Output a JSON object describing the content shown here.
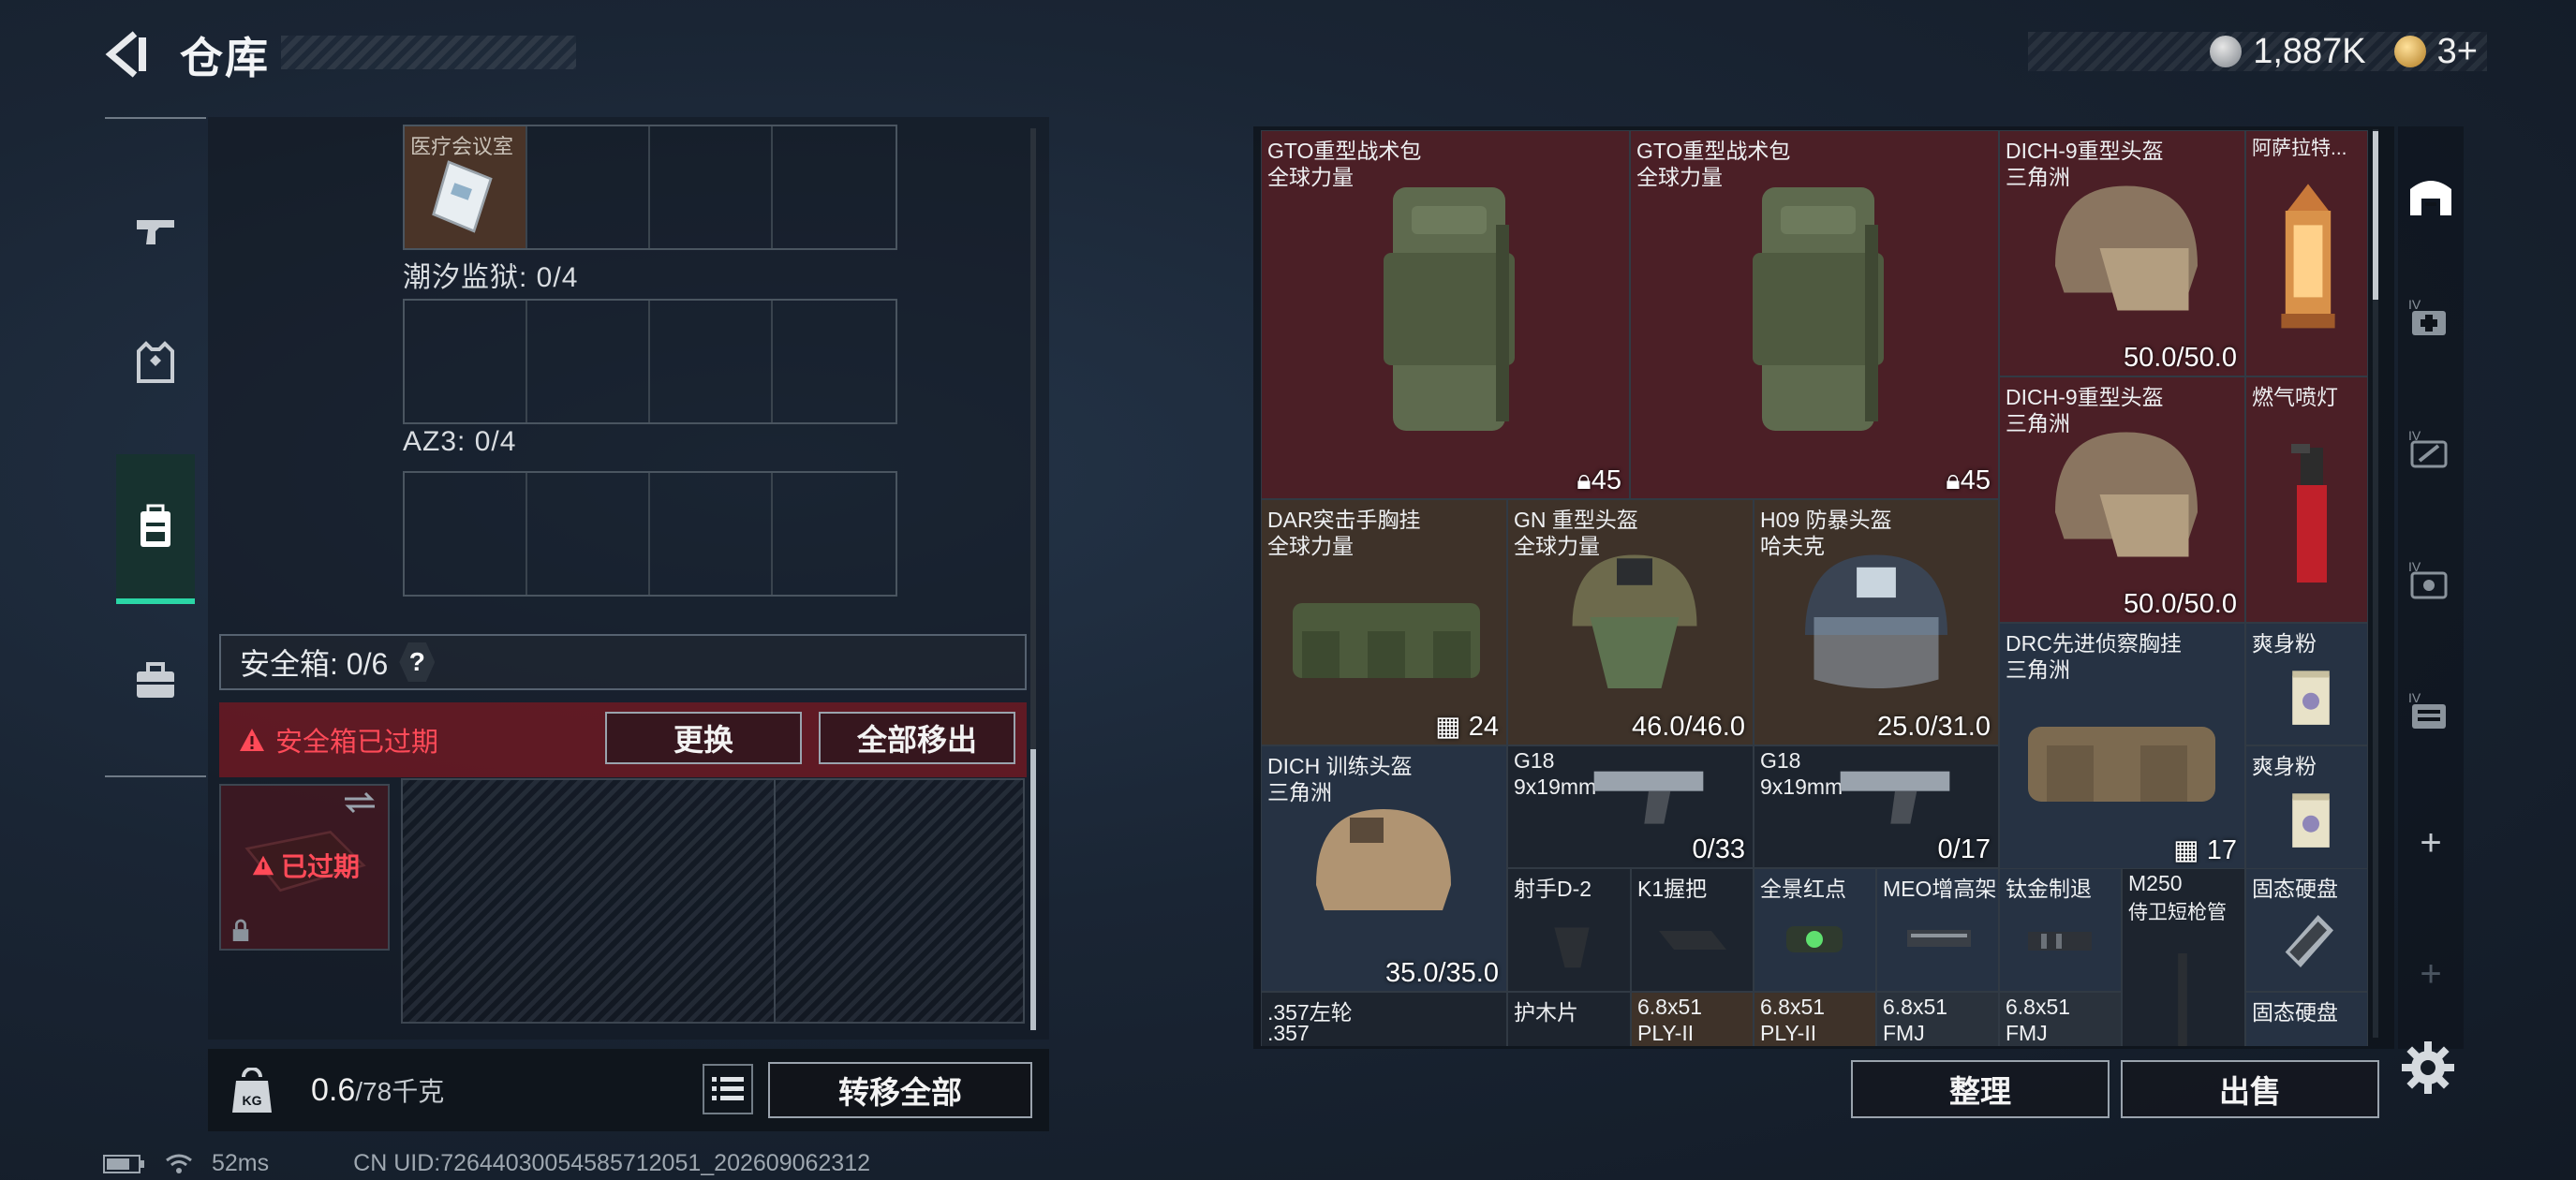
{
  "header": {
    "title": "仓库"
  },
  "currency": {
    "silver": "1,887K",
    "gold": "3+"
  },
  "left_panel": {
    "top_slot_label": "医疗会议室",
    "grid1_label": "潮汐监狱: 0/4",
    "grid2_label": "AZ3: 0/4",
    "safe_box": {
      "label": "安全箱: 0/6",
      "help": "?"
    },
    "expired_notice": "安全箱已过期",
    "replace_button": "更换",
    "move_all_button": "全部移出",
    "case_expired_label": "已过期"
  },
  "weight": {
    "current": "0.6",
    "max": "/78千克",
    "kg_icon_text": "KG"
  },
  "transfer_all_button": "转移全部",
  "inventory": {
    "items": [
      {
        "name": "GTO重型战术包",
        "sub": "全球力量",
        "stat": "45",
        "type": "backpack"
      },
      {
        "name": "GTO重型战术包",
        "sub": "全球力量",
        "stat": "45",
        "type": "backpack"
      },
      {
        "name": "DICH-9重型头盔",
        "sub": "三角洲",
        "stat": "50.0/50.0",
        "type": "helmet"
      },
      {
        "name": "阿萨拉特...",
        "sub": "",
        "stat": "",
        "type": "lantern"
      },
      {
        "name": "DICH-9重型头盔",
        "sub": "三角洲",
        "stat": "50.0/50.0",
        "type": "helmet"
      },
      {
        "name": "燃气喷灯",
        "sub": "",
        "stat": "",
        "type": "torch"
      },
      {
        "name": "DAR突击手胸挂",
        "sub": "全球力量",
        "stat": "24",
        "type": "rig"
      },
      {
        "name": "GN 重型头盔",
        "sub": "全球力量",
        "stat": "46.0/46.0",
        "type": "helmet"
      },
      {
        "name": "H09 防暴头盔",
        "sub": "哈夫克",
        "stat": "25.0/31.0",
        "type": "helmet"
      },
      {
        "name": "DRC先进侦察胸挂",
        "sub": "三角洲",
        "stat": "17",
        "type": "rig"
      },
      {
        "name": "爽身粉",
        "sub": "",
        "stat": "",
        "type": "can"
      },
      {
        "name": "爽身粉",
        "sub": "",
        "stat": "",
        "type": "can"
      },
      {
        "name": "DICH 训练头盔",
        "sub": "三角洲",
        "stat": "35.0/35.0",
        "type": "helmet"
      },
      {
        "name": "G18",
        "sub": "9x19mm",
        "stat": "0/33",
        "type": "pistol"
      },
      {
        "name": "G18",
        "sub": "9x19mm",
        "stat": "0/17",
        "type": "pistol"
      },
      {
        "name": "射手D-2",
        "sub": "",
        "stat": "",
        "type": "part"
      },
      {
        "name": "K1握把",
        "sub": "",
        "stat": "",
        "type": "part"
      },
      {
        "name": "全景红点",
        "sub": "",
        "stat": "",
        "type": "part"
      },
      {
        "name": "MEO增高架",
        "sub": "",
        "stat": "",
        "type": "part"
      },
      {
        "name": "钛金制退",
        "sub": "",
        "stat": "",
        "type": "part"
      },
      {
        "name": "M250",
        "sub": "侍卫短枪管",
        "stat": "",
        "type": "part"
      },
      {
        "name": "固态硬盘",
        "sub": "",
        "stat": "",
        "type": "part"
      },
      {
        "name": ".357左轮",
        "sub": ".357",
        "stat": "",
        "type": "part"
      },
      {
        "name": "护木片",
        "sub": "",
        "stat": "",
        "type": "part"
      },
      {
        "name": "6.8x51",
        "sub": "PLY-II",
        "stat": "",
        "type": "ammo"
      },
      {
        "name": "6.8x51",
        "sub": "PLY-II",
        "stat": "",
        "type": "ammo"
      },
      {
        "name": "6.8x51",
        "sub": "FMJ",
        "stat": "",
        "type": "ammo"
      },
      {
        "name": "6.8x51",
        "sub": "FMJ",
        "stat": "",
        "type": "ammo"
      },
      {
        "name": "固态硬盘",
        "sub": "",
        "stat": "",
        "type": "part"
      }
    ]
  },
  "sort_button": "整理",
  "sell_button": "出售",
  "right_tabs": {
    "roman": "IV",
    "plus": "+"
  },
  "status_bar": {
    "ping": "52ms",
    "uid": "CN UID:72644030054585712051_202609062312"
  },
  "colors": {
    "accent": "#2bd6a6",
    "danger": "#ff4a58",
    "rare_red": "#4b1f26"
  }
}
